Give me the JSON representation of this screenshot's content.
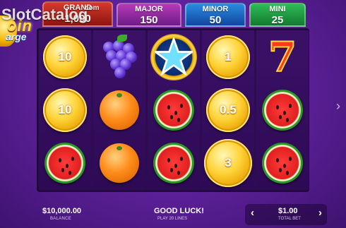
{
  "watermark": {
    "text": "SlotCatalog",
    "suffix": "com"
  },
  "logo": {
    "title": "oin",
    "subtitle": "arge"
  },
  "jackpots": {
    "grand": {
      "label": "GRAND",
      "value": "1,000"
    },
    "major": {
      "label": "MAJOR",
      "value": "150"
    },
    "minor": {
      "label": "MINOR",
      "value": "50"
    },
    "mini": {
      "label": "MINI",
      "value": "25"
    }
  },
  "reels": [
    [
      {
        "type": "coin",
        "value": "10"
      },
      {
        "type": "coin",
        "value": "10"
      },
      {
        "type": "watermelon"
      }
    ],
    [
      {
        "type": "grapes"
      },
      {
        "type": "orange"
      },
      {
        "type": "orange"
      }
    ],
    [
      {
        "type": "star"
      },
      {
        "type": "watermelon"
      },
      {
        "type": "watermelon"
      }
    ],
    [
      {
        "type": "coin",
        "value": "1"
      },
      {
        "type": "coin",
        "value": "0.5"
      },
      {
        "type": "coin",
        "value": "3"
      }
    ],
    [
      {
        "type": "seven"
      },
      {
        "type": "watermelon"
      },
      {
        "type": "watermelon"
      }
    ]
  ],
  "footer": {
    "balance_value": "$10,000.00",
    "balance_label": "BALANCE",
    "message": "GOOD LUCK!",
    "lines": "PLAY 20 LINES",
    "bet_value": "$1.00",
    "bet_label": "TOTAL BET",
    "prev_arrow": "‹",
    "next_arrow": "›"
  }
}
